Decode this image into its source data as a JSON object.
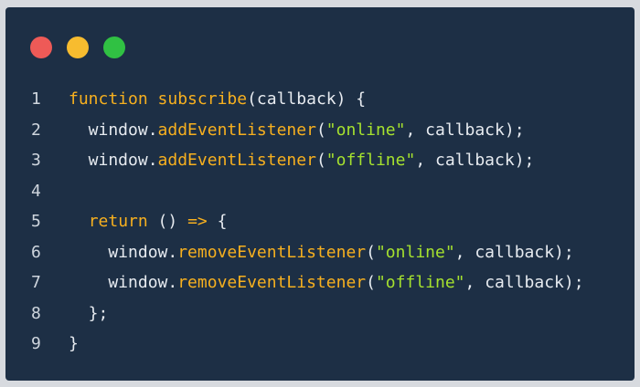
{
  "window": {
    "buttons": [
      "close",
      "minimize",
      "maximize"
    ],
    "colors": {
      "background": "#1d2f45",
      "close": "#ee5a57",
      "minimize": "#f7bc2f",
      "maximize": "#30c143",
      "keyword": "#f7b01f",
      "string": "#a6e22e",
      "text": "#e7ebf0"
    }
  },
  "code": {
    "lines": [
      {
        "n": "1",
        "tokens": [
          [
            "kw",
            "function"
          ],
          [
            "plain",
            " "
          ],
          [
            "fn",
            "subscribe"
          ],
          [
            "plain",
            "(callback) {"
          ]
        ]
      },
      {
        "n": "2",
        "tokens": [
          [
            "plain",
            "  window."
          ],
          [
            "fn",
            "addEventListener"
          ],
          [
            "plain",
            "("
          ],
          [
            "str",
            "\"online\""
          ],
          [
            "plain",
            ", callback);"
          ]
        ]
      },
      {
        "n": "3",
        "tokens": [
          [
            "plain",
            "  window."
          ],
          [
            "fn",
            "addEventListener"
          ],
          [
            "plain",
            "("
          ],
          [
            "str",
            "\"offline\""
          ],
          [
            "plain",
            ", callback);"
          ]
        ]
      },
      {
        "n": "4",
        "tokens": []
      },
      {
        "n": "5",
        "tokens": [
          [
            "plain",
            "  "
          ],
          [
            "kw",
            "return"
          ],
          [
            "plain",
            " () "
          ],
          [
            "kw",
            "=>"
          ],
          [
            "plain",
            " {"
          ]
        ]
      },
      {
        "n": "6",
        "tokens": [
          [
            "plain",
            "    window."
          ],
          [
            "fn",
            "removeEventListener"
          ],
          [
            "plain",
            "("
          ],
          [
            "str",
            "\"online\""
          ],
          [
            "plain",
            ", callback);"
          ]
        ]
      },
      {
        "n": "7",
        "tokens": [
          [
            "plain",
            "    window."
          ],
          [
            "fn",
            "removeEventListener"
          ],
          [
            "plain",
            "("
          ],
          [
            "str",
            "\"offline\""
          ],
          [
            "plain",
            ", callback);"
          ]
        ]
      },
      {
        "n": "8",
        "tokens": [
          [
            "plain",
            "  };"
          ]
        ]
      },
      {
        "n": "9",
        "tokens": [
          [
            "plain",
            "}"
          ]
        ]
      }
    ]
  }
}
